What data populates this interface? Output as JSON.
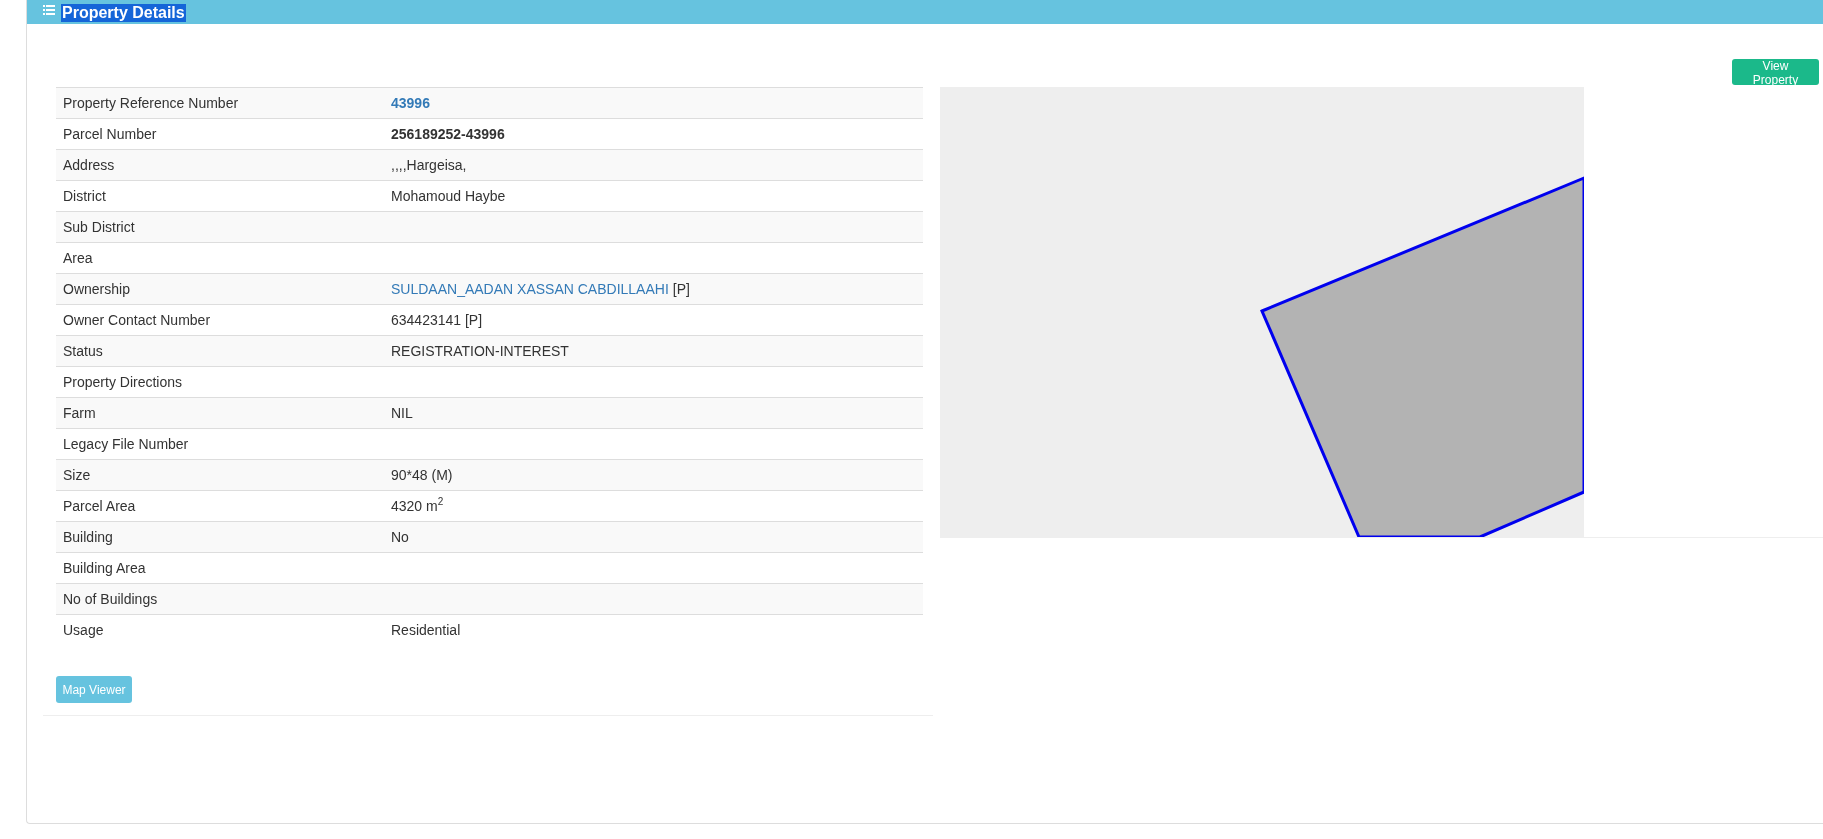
{
  "panel": {
    "title": "Property Details",
    "title_highlighted": true
  },
  "view_button": "View Property",
  "details": [
    {
      "label": "Property Reference Number",
      "kind": "ref",
      "value": "43996"
    },
    {
      "label": "Parcel Number",
      "kind": "bold",
      "value": "256189252-43996"
    },
    {
      "label": "Address",
      "kind": "text",
      "value": ",,,,Hargeisa,"
    },
    {
      "label": "District",
      "kind": "text",
      "value": "Mohamoud Haybe"
    },
    {
      "label": "Sub District",
      "kind": "text"
    },
    {
      "label": "Area",
      "kind": "text"
    },
    {
      "label": "Ownership",
      "kind": "owner",
      "link": "SULDAAN_AADAN XASSAN CABDILLAAHI",
      "value": "[P]"
    },
    {
      "label": "Owner Contact Number",
      "kind": "text",
      "value": "634423141 [P]"
    },
    {
      "label": "Status",
      "kind": "text",
      "value": "REGISTRATION-INTEREST"
    },
    {
      "label": "Property Directions",
      "kind": "text"
    },
    {
      "label": "Farm",
      "kind": "text",
      "value": "NIL"
    },
    {
      "label": "Legacy File Number",
      "kind": "text"
    },
    {
      "label": "Size",
      "kind": "text",
      "value": "90*48 (M)"
    },
    {
      "label": "Parcel Area",
      "kind": "text",
      "value": "4320 m$^{2}$"
    },
    {
      "label": "Building",
      "kind": "text",
      "value": "No"
    },
    {
      "label": "Building Area",
      "kind": "text"
    },
    {
      "label": "No of Buildings",
      "kind": "text"
    },
    {
      "label": "Usage",
      "kind": "text",
      "value": "Residential"
    }
  ],
  "map_button": "Map Viewer"
}
